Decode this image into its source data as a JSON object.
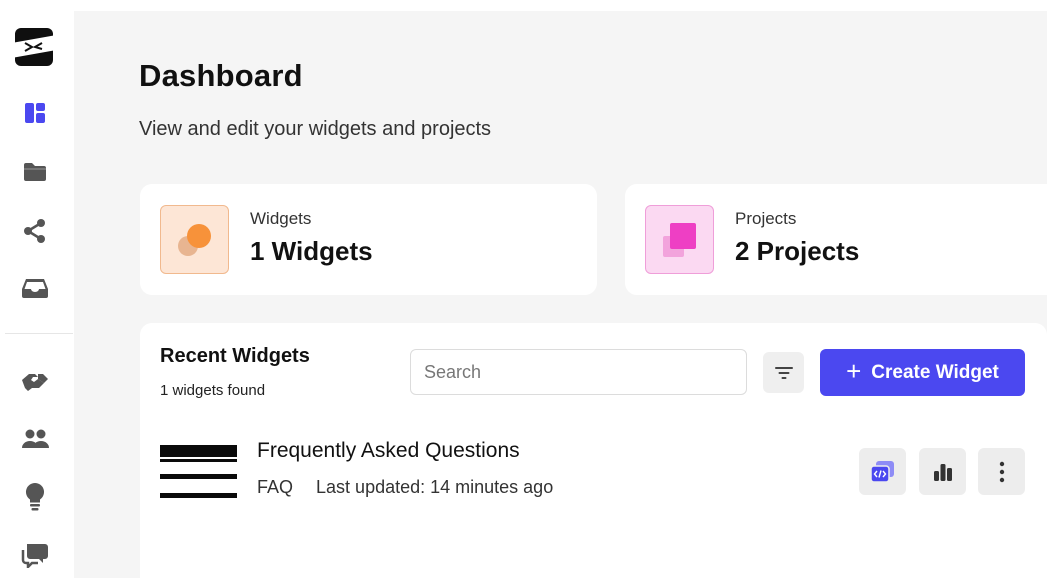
{
  "sidebar": {
    "items": [
      {
        "name": "dashboard",
        "icon": "dashboard-icon",
        "active": true
      },
      {
        "name": "projects",
        "icon": "folder-icon"
      },
      {
        "name": "share",
        "icon": "share-icon"
      },
      {
        "name": "inbox",
        "icon": "inbox-icon"
      },
      {
        "name": "integrations",
        "icon": "handshake-icon"
      },
      {
        "name": "team",
        "icon": "users-icon"
      },
      {
        "name": "ideas",
        "icon": "lightbulb-icon"
      },
      {
        "name": "feedback",
        "icon": "chat-icon"
      }
    ],
    "active_color": "#4b48f0",
    "icon_color": "#555555"
  },
  "header": {
    "title": "Dashboard",
    "subtitle": "View and edit your widgets and projects"
  },
  "stats": {
    "widgets": {
      "label": "Widgets",
      "value": "1 Widgets",
      "icon": "widgets-icon",
      "color": "#f7923a"
    },
    "projects": {
      "label": "Projects",
      "value": "2 Projects",
      "icon": "projects-icon",
      "color": "#ee3fc4"
    }
  },
  "recent": {
    "title": "Recent Widgets",
    "count": "1 widgets found",
    "search_placeholder": "Search",
    "create_label": "Create Widget",
    "accent": "#4b48f0",
    "widgets": [
      {
        "name": "Frequently Asked Questions",
        "type": "FAQ",
        "updated": "Last updated: 14 minutes ago"
      }
    ]
  }
}
